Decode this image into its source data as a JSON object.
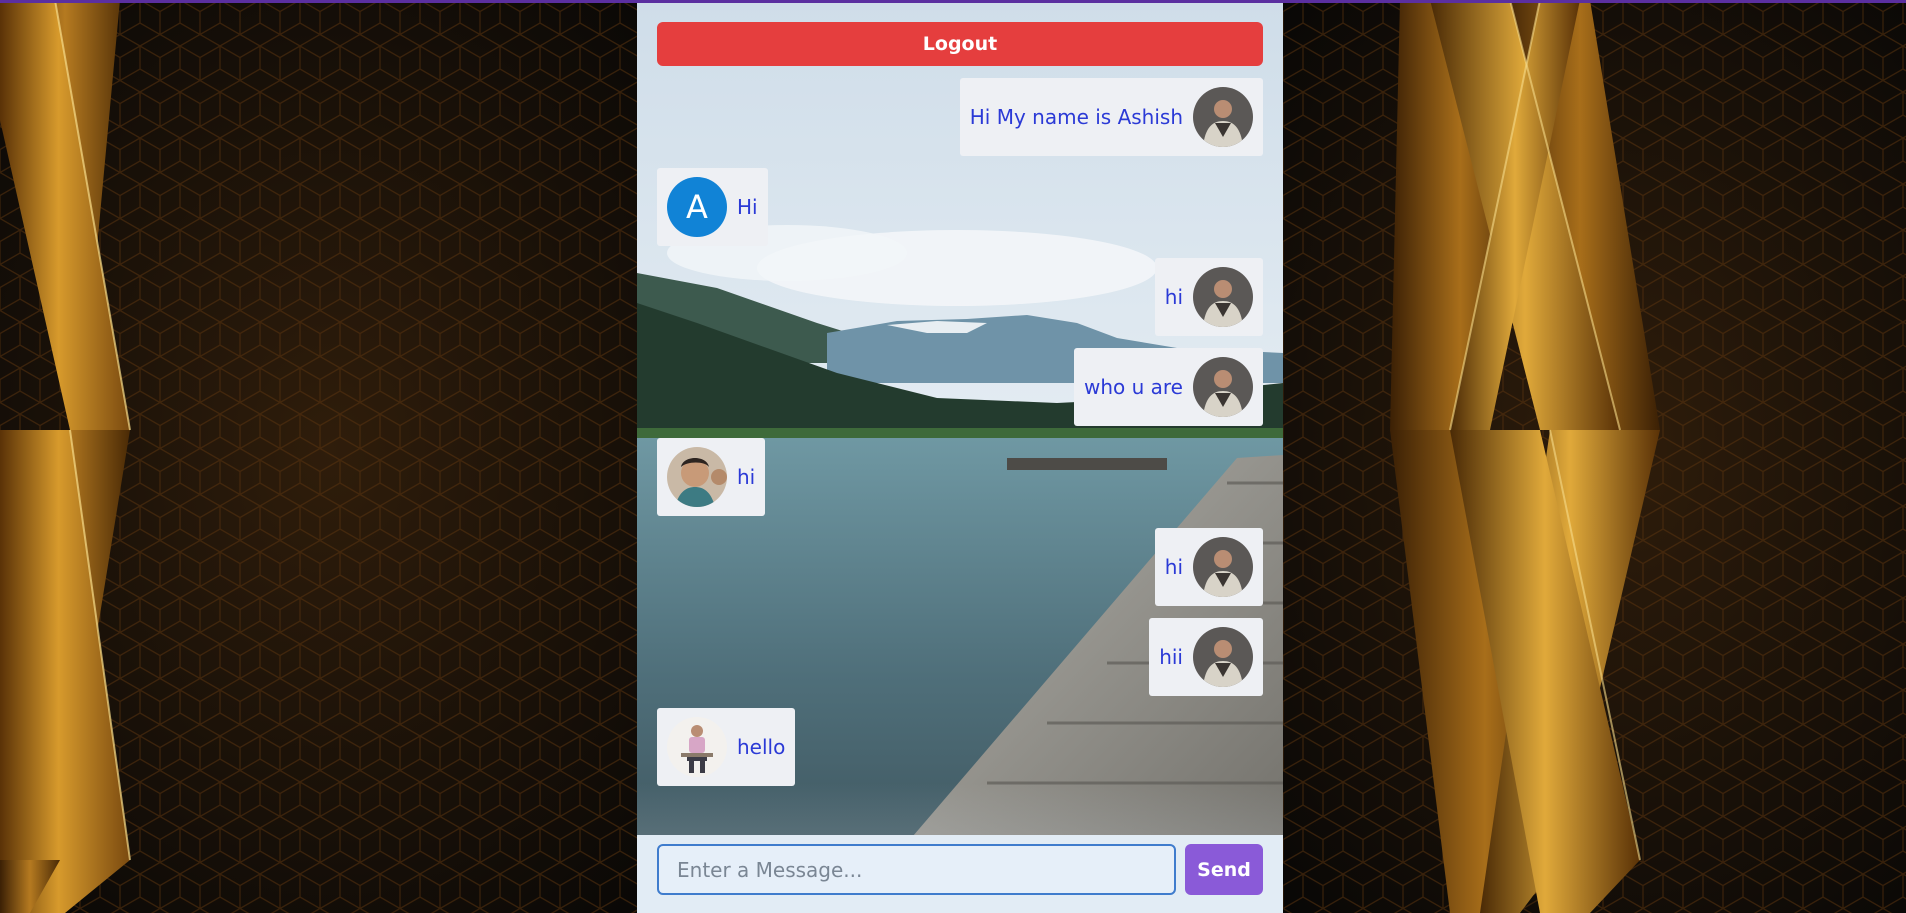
{
  "chat": {
    "logout_label": "Logout",
    "messages": [
      {
        "text": "Hi My name is Ashish",
        "side": "right",
        "avatar": "photo-man-jacket-icon"
      },
      {
        "text": "Hi",
        "side": "left",
        "avatar": "letter",
        "avatar_letter": "A"
      },
      {
        "text": "hi",
        "side": "right",
        "avatar": "photo-man-jacket-icon"
      },
      {
        "text": "who u are",
        "side": "right",
        "avatar": "photo-man-jacket-icon"
      },
      {
        "text": "hi",
        "side": "left",
        "avatar": "photo-man-face-icon"
      },
      {
        "text": "hi",
        "side": "right",
        "avatar": "photo-man-jacket-icon"
      },
      {
        "text": "hii",
        "side": "right",
        "avatar": "photo-man-jacket-icon"
      },
      {
        "text": "hello",
        "side": "left",
        "avatar": "photo-man-sitting-icon"
      }
    ]
  },
  "composer": {
    "placeholder": "Enter a Message...",
    "value": "",
    "send_label": "Send"
  },
  "colors": {
    "logout": "#e53e3e",
    "send": "#8a5ad8",
    "message_text": "#2b3ad6",
    "letter_avatar": "#1183d6"
  }
}
